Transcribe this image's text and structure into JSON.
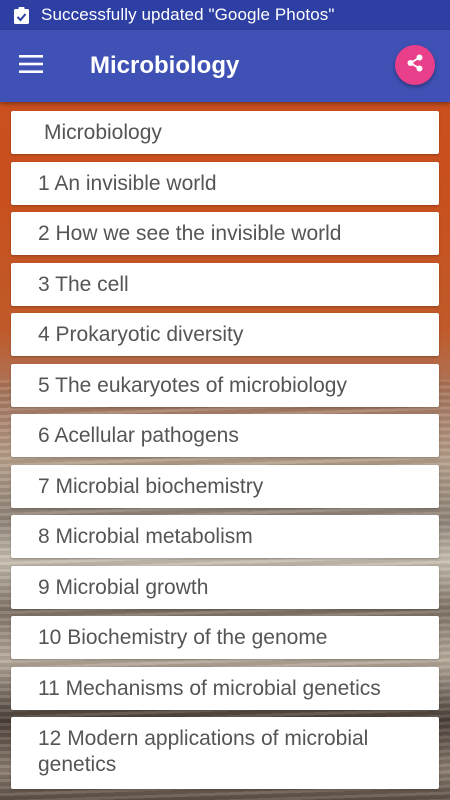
{
  "status_bar": {
    "icon": "clipboard-check-icon",
    "text": "Successfully updated \"Google Photos\""
  },
  "app_bar": {
    "menu_icon": "hamburger-menu-icon",
    "title": "Microbiology",
    "share_icon": "share-icon",
    "colors": {
      "status_bar": "#2d3fa3",
      "app_bar": "#3f51b5",
      "share_button": "#e93f8a"
    }
  },
  "list": {
    "items": [
      {
        "label": "Microbiology"
      },
      {
        "label": "1 An invisible world"
      },
      {
        "label": "2 How we see the invisible world"
      },
      {
        "label": "3 The cell"
      },
      {
        "label": "4 Prokaryotic diversity"
      },
      {
        "label": "5 The eukaryotes of microbiology"
      },
      {
        "label": "6 Acellular pathogens"
      },
      {
        "label": "7 Microbial biochemistry"
      },
      {
        "label": "8 Microbial metabolism"
      },
      {
        "label": "9 Microbial growth"
      },
      {
        "label": "10 Biochemistry of the genome"
      },
      {
        "label": "11 Mechanisms of microbial genetics"
      },
      {
        "label": "12 Modern applications of microbial genetics"
      }
    ]
  }
}
